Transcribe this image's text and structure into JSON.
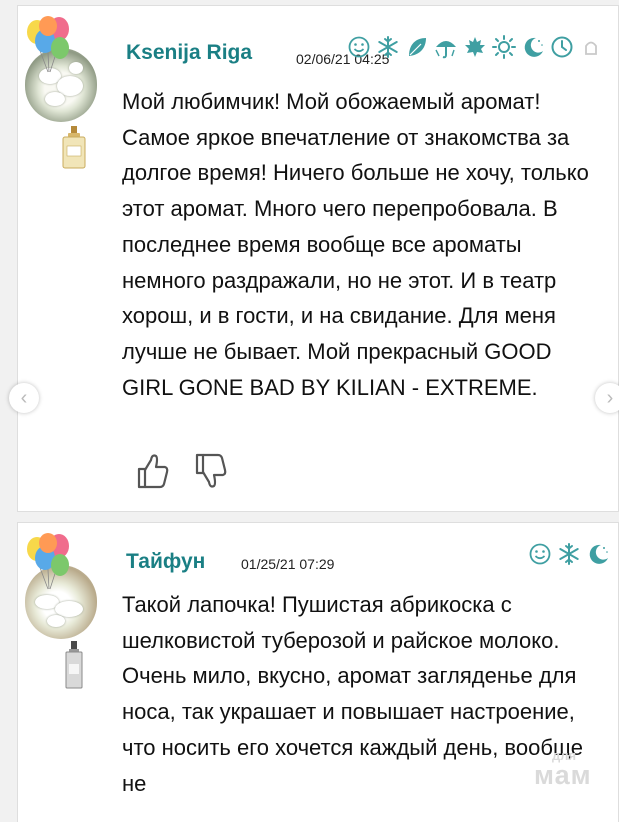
{
  "colors": {
    "accent": "#1a7f84",
    "icon": "#3f9fa2",
    "icon_inactive": "#c9c9c9"
  },
  "reviews": [
    {
      "username": "Ksenija Riga",
      "date": "02/06/21 04:25",
      "season_icons": [
        "smile-icon",
        "snowflake-icon",
        "leaf-icon",
        "umbrella-icon",
        "maple-leaf-icon",
        "sun-icon",
        "moon-icon",
        "clock-icon",
        "extra-icon"
      ],
      "text": "Мой любимчик! Мой обожаемый аромат! Самое яркое впечатление от знакомства за долгое время! Ничего больше не хочу, только этот аромат. Много чего перепробовала. В последнее время вообще все ароматы немного раздражали, но не этот. И в театр хорош, и в гости, и на свидание. Для меня лучше не бывает. Мой прекрасный GOOD GIRL GONE BAD BY KILIAN - EXTREME."
    },
    {
      "username": "Тайфун",
      "date": "01/25/21 07:29",
      "season_icons": [
        "smile-icon",
        "snowflake-icon",
        "moon-icon"
      ],
      "text": "Такой лапочка! Пушистая абрикоска с шелковистой туберозой и райское молоко. Очень мило, вкусно, аромат загляденье для носа, так украшает и повышает настроение, что носить его хочется каждый день, вообще не"
    }
  ],
  "watermark": {
    "small": "для",
    "big": "мам"
  }
}
